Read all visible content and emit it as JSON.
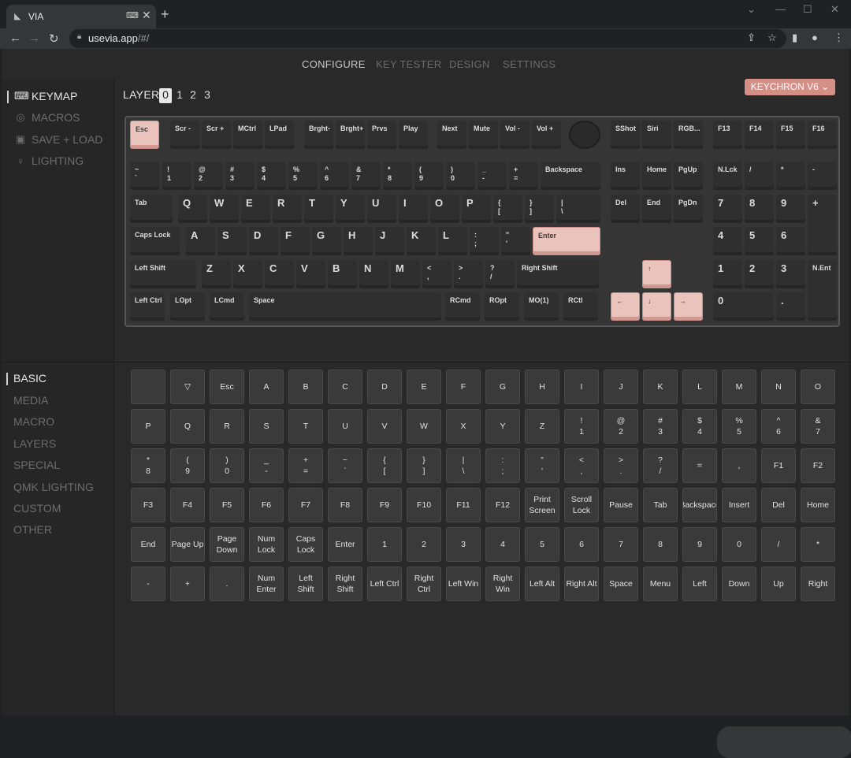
{
  "browser": {
    "tab_title": "VIA",
    "url_host": "usevia.app",
    "url_path": "/#/",
    "win_min": "—",
    "win_max": "☐",
    "win_close": "✕"
  },
  "top_nav": [
    "CONFIGURE",
    "KEY TESTER",
    "DESIGN",
    "SETTINGS"
  ],
  "side_top": [
    "KEYMAP",
    "MACROS",
    "SAVE + LOAD",
    "LIGHTING"
  ],
  "side_bottom": [
    "BASIC",
    "MEDIA",
    "MACRO",
    "LAYERS",
    "SPECIAL",
    "QMK LIGHTING",
    "CUSTOM",
    "OTHER"
  ],
  "layer": {
    "label": "LAYER",
    "numbers": [
      "0",
      "1",
      "2",
      "3"
    ],
    "selected": "0"
  },
  "keyboard_name": "KEYCHRON V6",
  "keyboard": {
    "row0": [
      "Esc",
      "Scr -",
      "Scr +",
      "MCtrl",
      "LPad",
      "Brght-",
      "Brght+",
      "Prvs",
      "Play",
      "Next",
      "Mute",
      "Vol -",
      "Vol +",
      "",
      "SShot",
      "Siri",
      "RGB...",
      "F13",
      "F14",
      "F15",
      "F16"
    ],
    "row1": [
      "~\n`",
      "!\n1",
      "@\n2",
      "#\n3",
      "$\n4",
      "%\n5",
      "^\n6",
      "&\n7",
      "*\n8",
      "(\n9",
      ")\n0",
      "_\n-",
      "+\n=",
      "Backspace",
      "Ins",
      "Home",
      "PgUp",
      "N.Lck",
      "/",
      "*",
      "-"
    ],
    "row2": [
      "Tab",
      "Q",
      "W",
      "E",
      "R",
      "T",
      "Y",
      "U",
      "I",
      "O",
      "P",
      "{\n[",
      "}\n]",
      "|\n\\",
      "Del",
      "End",
      "PgDn",
      "7",
      "8",
      "9",
      "+"
    ],
    "row3": [
      "Caps Lock",
      "A",
      "S",
      "D",
      "F",
      "G",
      "H",
      "J",
      "K",
      "L",
      ":\n;",
      "\"\n'",
      "Enter",
      "4",
      "5",
      "6"
    ],
    "row4": [
      "Left Shift",
      "Z",
      "X",
      "C",
      "V",
      "B",
      "N",
      "M",
      "<\n,",
      ">\n.",
      "?\n/",
      "Right Shift",
      "↑",
      "1",
      "2",
      "3",
      "N.Ent"
    ],
    "row5": [
      "Left Ctrl",
      "LOpt",
      "LCmd",
      "Space",
      "RCmd",
      "ROpt",
      "MO(1)",
      "RCtl",
      "←",
      "↓",
      "→",
      "0",
      "."
    ]
  },
  "picker_keys": [
    "",
    "▽",
    "Esc",
    "A",
    "B",
    "C",
    "D",
    "E",
    "F",
    "G",
    "H",
    "I",
    "J",
    "K",
    "L",
    "M",
    "N",
    "O",
    "P",
    "Q",
    "R",
    "S",
    "T",
    "U",
    "V",
    "W",
    "X",
    "Y",
    "Z",
    "!\n1",
    "@\n2",
    "#\n3",
    "$\n4",
    "%\n5",
    "^\n6",
    "&\n7",
    "*\n8",
    "(\n9",
    ")\n0",
    "_\n-",
    "+\n=",
    "~\n`",
    "{\n[",
    "}\n]",
    "|\n\\",
    ":\n;",
    "\"\n'",
    "<\n,",
    ">\n.",
    "?\n/",
    "=",
    ",",
    "F1",
    "F2",
    "F3",
    "F4",
    "F5",
    "F6",
    "F7",
    "F8",
    "F9",
    "F10",
    "F11",
    "F12",
    "Print\nScreen",
    "Scroll\nLock",
    "Pause",
    "Tab",
    "Backspace",
    "Insert",
    "Del",
    "Home",
    "End",
    "Page Up",
    "Page\nDown",
    "Num\nLock",
    "Caps\nLock",
    "Enter",
    "1",
    "2",
    "3",
    "4",
    "5",
    "6",
    "7",
    "8",
    "9",
    "0",
    "/",
    "*",
    "-",
    "+",
    ".",
    "Num\nEnter",
    "Left\nShift",
    "Right\nShift",
    "Left Ctrl",
    "Right\nCtrl",
    "Left Win",
    "Right\nWin",
    "Left Alt",
    "Right Alt",
    "Space",
    "Menu",
    "Left",
    "Down",
    "Up",
    "Right"
  ],
  "colors": {
    "accent": "#e9c3bc",
    "selector": "#d48f86",
    "background": "#292929"
  }
}
